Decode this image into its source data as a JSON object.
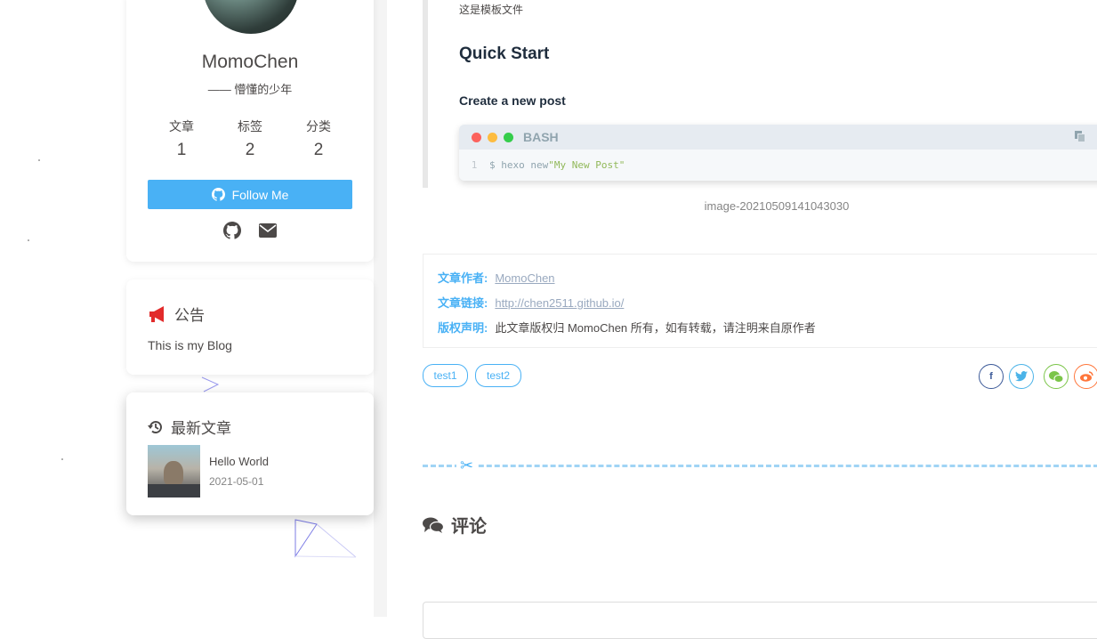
{
  "sidebar": {
    "author": {
      "name": "MomoChen",
      "description": "—— 懵懂的少年",
      "stats": [
        {
          "label": "文章",
          "value": "1"
        },
        {
          "label": "标签",
          "value": "2"
        },
        {
          "label": "分类",
          "value": "2"
        }
      ],
      "follow_label": "Follow Me",
      "social_icons": [
        "github-icon",
        "envelope-icon"
      ]
    },
    "announcement": {
      "title": "公告",
      "text": "This is my Blog"
    },
    "recent": {
      "title": "最新文章",
      "items": [
        {
          "title": "Hello World",
          "date": "2021-05-01"
        }
      ]
    }
  },
  "post": {
    "template_note": "这是模板文件",
    "heading": "Quick Start",
    "subheading": "Create a new post",
    "code": {
      "lang": "BASH",
      "line_number": "1",
      "command": "$ hexo new ",
      "string": "\"My New Post\""
    },
    "image_caption": "image-20210509141043030",
    "copyright": {
      "author_key": "文章作者:",
      "author_value": "MomoChen",
      "link_key": "文章链接:",
      "link_value": "http://chen2511.github.io/",
      "license_key": "版权声明:",
      "license_value": "此文章版权归 MomoChen 所有，如有转载，请注明来自原作者"
    },
    "tags": [
      "test1",
      "test2"
    ],
    "share_icons": [
      "facebook-icon",
      "twitter-icon",
      "wechat-icon",
      "weibo-icon"
    ],
    "comments_title": "评论"
  },
  "colors": {
    "accent": "#49b1f5",
    "text": "#4c4948",
    "heading": "#1f2d3d",
    "announce_icon": "#e22b2b"
  }
}
